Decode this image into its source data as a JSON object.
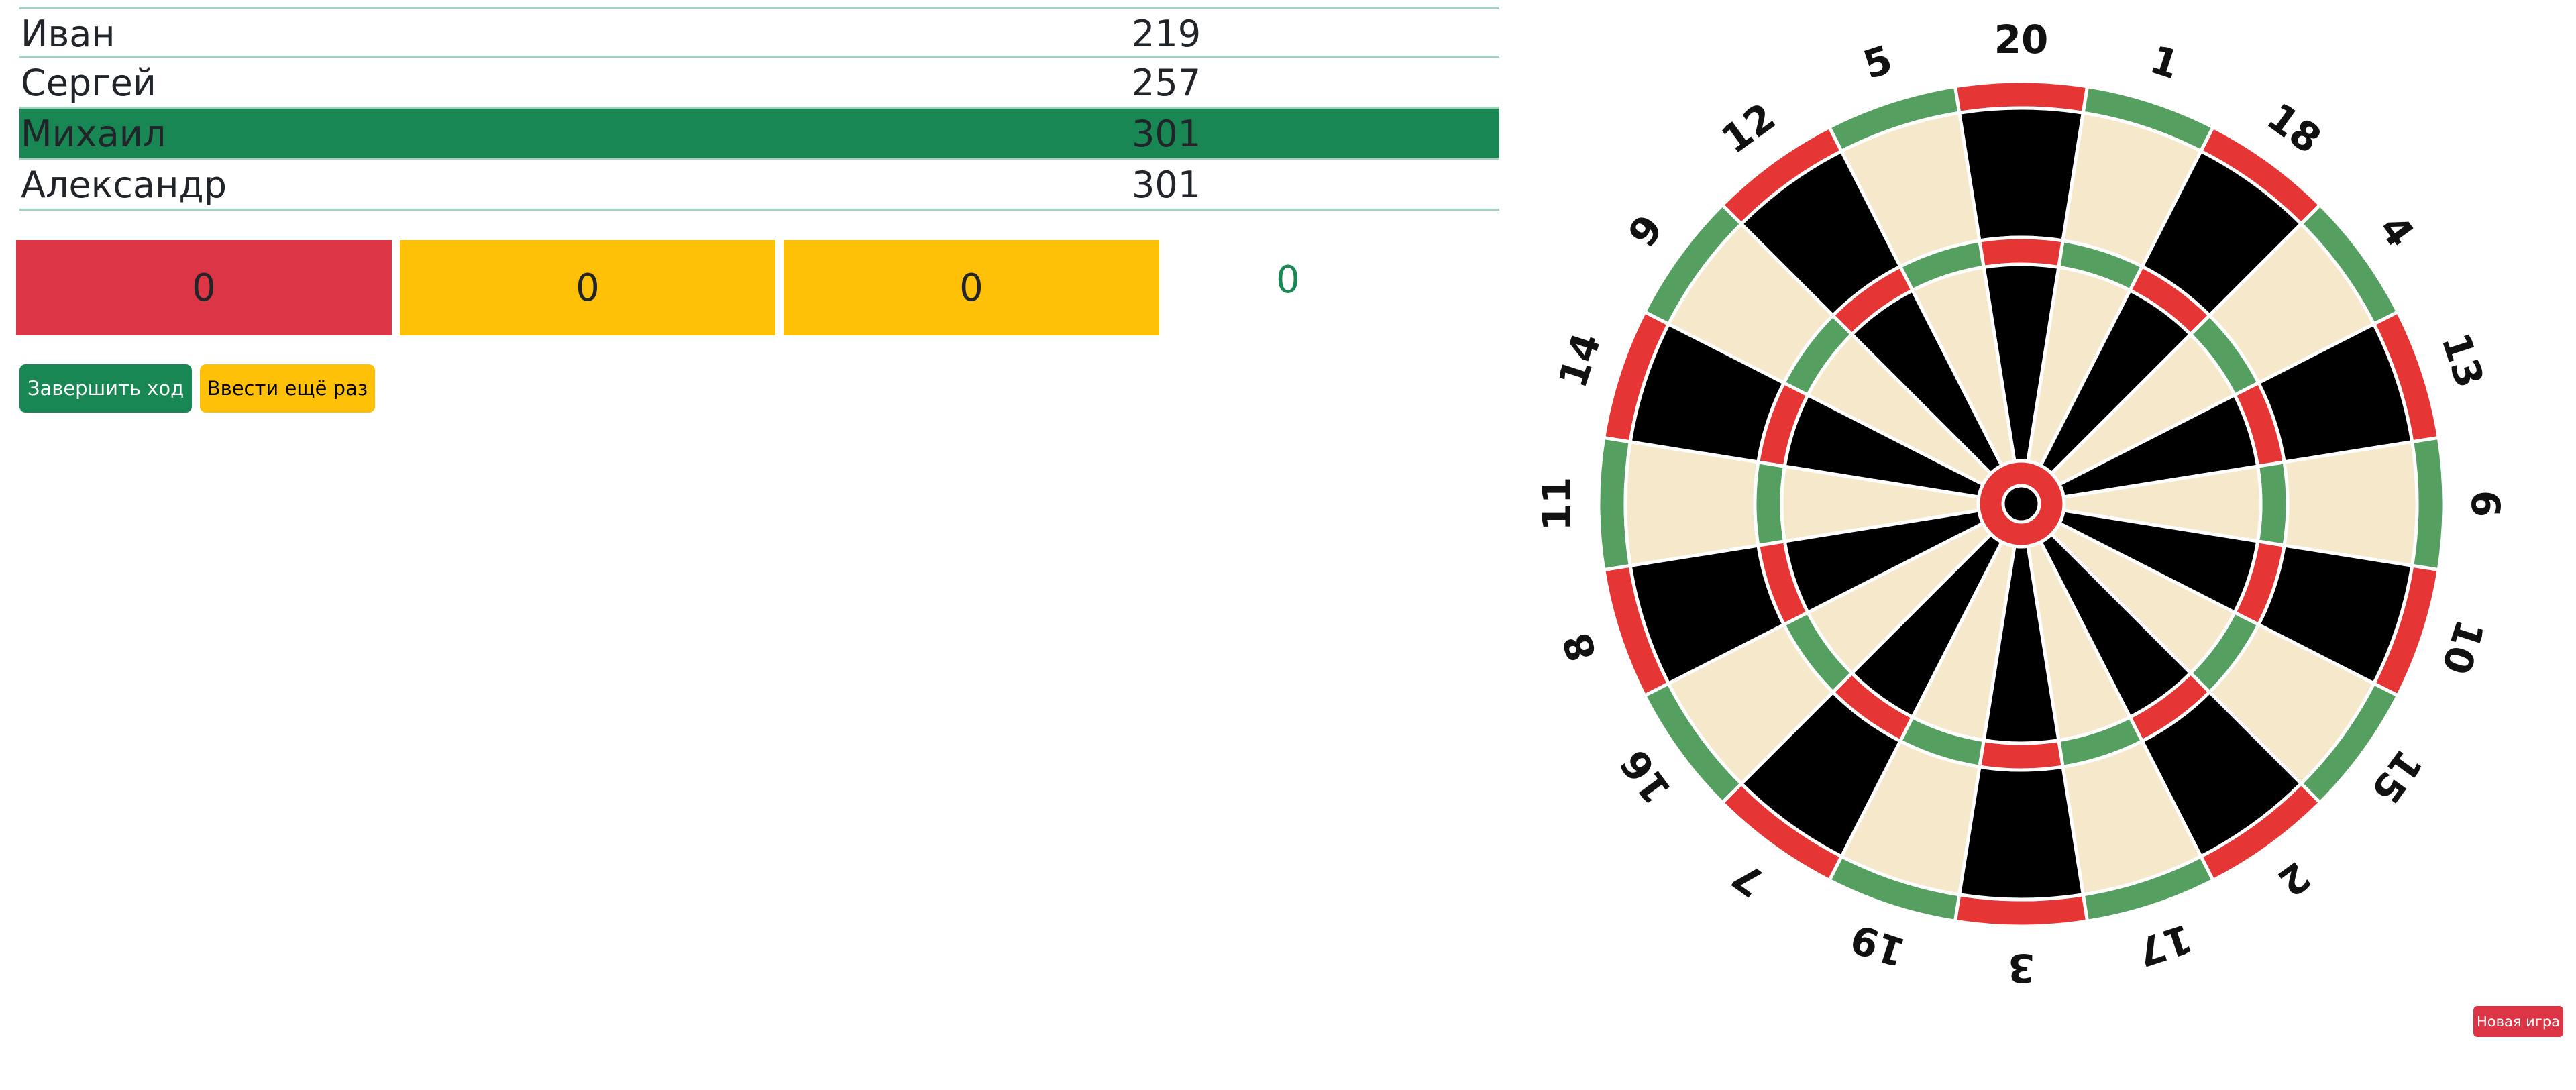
{
  "players": [
    {
      "name": "Иван",
      "score": "219",
      "active": false
    },
    {
      "name": "Сергей",
      "score": "257",
      "active": false
    },
    {
      "name": "Михаил",
      "score": "301",
      "active": true
    },
    {
      "name": "Александр",
      "score": "301",
      "active": false
    }
  ],
  "throws": {
    "first": "0",
    "second": "0",
    "third": "0",
    "total": "0"
  },
  "buttons": {
    "end_turn": "Завершить ход",
    "reenter": "Ввести ещё раз",
    "new_game": "Новая игра"
  },
  "dartboard": {
    "numbers": [
      "20",
      "1",
      "18",
      "4",
      "13",
      "6",
      "10",
      "15",
      "2",
      "17",
      "3",
      "19",
      "7",
      "16",
      "8",
      "11",
      "14",
      "9",
      "12",
      "5"
    ],
    "colors": {
      "black": "#000000",
      "cream": "#f5e8cb",
      "red": "#e63535",
      "green": "#55a060",
      "wire": "#ffffff"
    }
  },
  "colors": {
    "accent_green": "#198754",
    "first_throw": "#dc3545",
    "other_throw": "#ffc107",
    "row_border": "#9fd3bd"
  }
}
